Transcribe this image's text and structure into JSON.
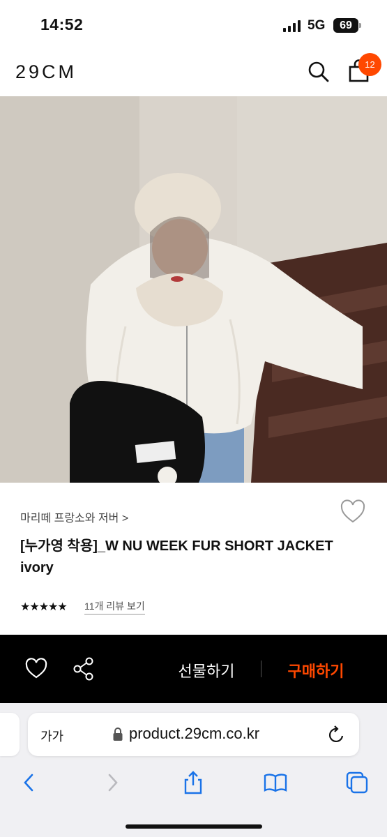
{
  "status": {
    "time": "14:52",
    "network": "5G",
    "battery": "69"
  },
  "header": {
    "logo": "29CM",
    "cart_count": "12"
  },
  "product": {
    "brand": "마리떼 프랑소와 저버 >",
    "title": "[누가영 착용]_W NU WEEK FUR SHORT JACKET ivory",
    "rating_stars": "★★★★★",
    "review_link": "11개 리뷰 보기"
  },
  "actions": {
    "gift": "선물하기",
    "buy": "구매하기"
  },
  "browser": {
    "text_size": "가가",
    "url": "product.29cm.co.kr"
  },
  "icons": {
    "search": "search-icon",
    "cart": "shopping-bag-icon",
    "wishlist": "heart-icon",
    "share": "share-icon",
    "back": "chevron-left-icon",
    "forward": "chevron-right-icon",
    "share_sheet": "share-sheet-icon",
    "bookmarks": "book-icon",
    "tabs": "tabs-icon",
    "lock": "lock-icon",
    "reload": "reload-icon"
  },
  "colors": {
    "accent": "#ff4800",
    "action_bar": "#000000",
    "browser_bg": "#f0f0f3"
  }
}
